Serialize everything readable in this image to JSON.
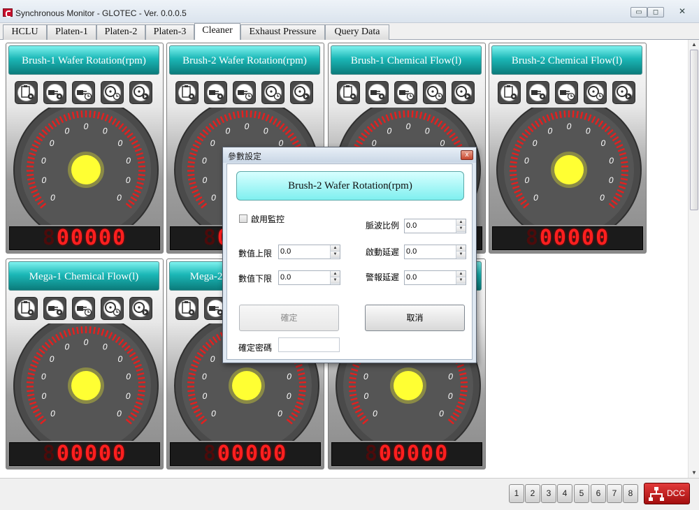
{
  "window": {
    "title": "Synchronous Monitor - GLOTEC - Ver. 0.0.0.5",
    "min_label": "▭",
    "max_label": "◻",
    "close_label": "✕"
  },
  "tabs": [
    {
      "label": "HCLU"
    },
    {
      "label": "Platen-1"
    },
    {
      "label": "Platen-2"
    },
    {
      "label": "Platen-3"
    },
    {
      "label": "Cleaner"
    },
    {
      "label": "Exhaust Pressure"
    },
    {
      "label": "Query Data"
    }
  ],
  "active_tab": "Cleaner",
  "gauge_tick_label": "0",
  "tool_icons": [
    "clipboard-gear-icon",
    "plug-gear-icon",
    "plug-clock-icon",
    "disc-clock-icon",
    "disc-arrow-icon"
  ],
  "panels": [
    {
      "title": "Brush-1 Wafer Rotation(rpm)",
      "display_ghost": "8",
      "display_value": "00000"
    },
    {
      "title": "Brush-2 Wafer Rotation(rpm)",
      "display_ghost": "8",
      "display_value": "00000"
    },
    {
      "title": "Brush-1 Chemical Flow(l)",
      "display_ghost": "8",
      "display_value": "00000"
    },
    {
      "title": "Brush-2 Chemical Flow(l)",
      "display_ghost": "8",
      "display_value": "00000"
    },
    {
      "title": "Mega-1 Chemical Flow(l)",
      "display_ghost": "8",
      "display_value": "00000"
    },
    {
      "title": "Mega-2 Chemical Flow(l)",
      "display_ghost": "8",
      "display_value": "00000"
    },
    {
      "title": "",
      "display_ghost": "8",
      "display_value": "00000"
    }
  ],
  "dialog": {
    "title": "參數設定",
    "close_label": "x",
    "header": "Brush-2 Wafer Rotation(rpm)",
    "enable_monitor_label": "啟用監控",
    "enable_monitor_checked": false,
    "upper_limit_label": "數值上限",
    "upper_limit_value": "0.0",
    "lower_limit_label": "數值下限",
    "lower_limit_value": "0.0",
    "pulse_ratio_label": "脈波比例",
    "pulse_ratio_value": "0.0",
    "start_delay_label": "啟動延遲",
    "start_delay_value": "0.0",
    "alarm_delay_label": "警報延遲",
    "alarm_delay_value": "0.0",
    "confirm_label": "確定",
    "cancel_label": "取消",
    "password_label": "確定密碼",
    "password_value": ""
  },
  "statusbar": {
    "pages": [
      "1",
      "2",
      "3",
      "4",
      "5",
      "6",
      "7",
      "8"
    ],
    "dcc_label": "DCC"
  },
  "colors": {
    "panel_title": "#1bb7b6",
    "gauge_needle": "#ffff33",
    "display_red": "#ff1f1f",
    "dcc_red": "#c41919"
  }
}
